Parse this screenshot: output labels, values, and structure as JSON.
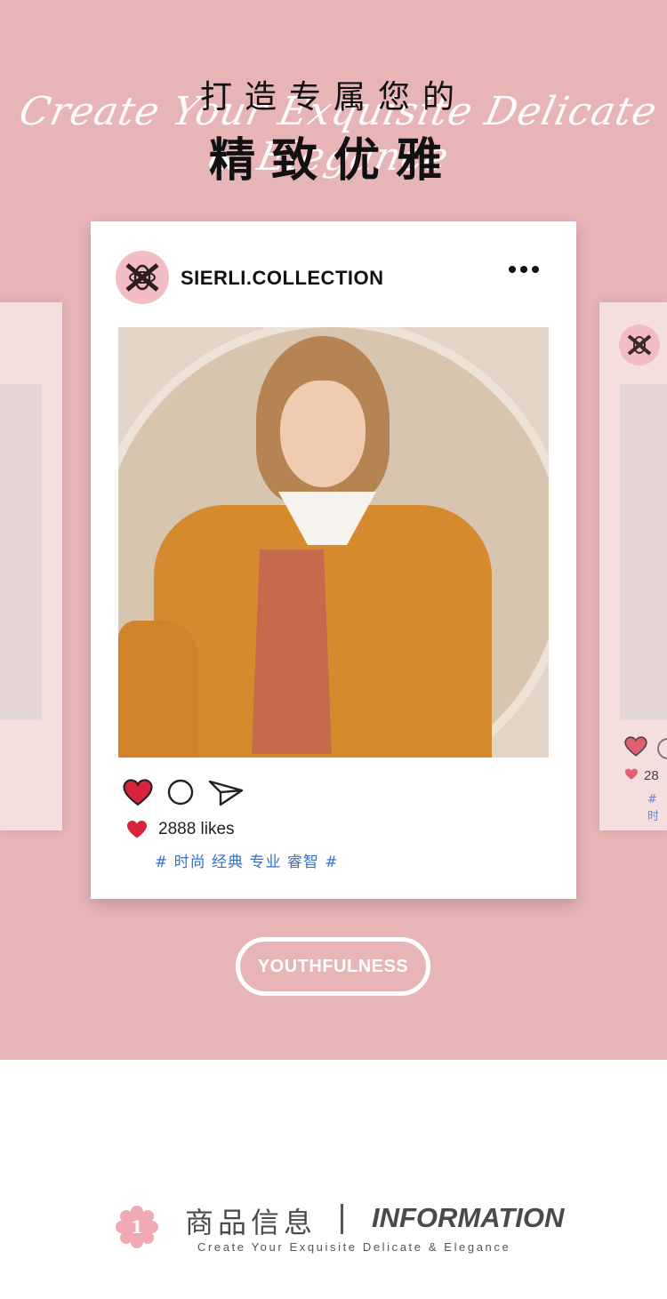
{
  "header": {
    "title_line1": "打造专属您的",
    "title_line2": "精致优雅",
    "script_text": "Create Your Exquisite Delicate & Elegance"
  },
  "post": {
    "username": "SIERLI.COLLECTION",
    "likes_text": "2888 likes",
    "tags": "# 时尚 经典 专业 睿智 #"
  },
  "side_post": {
    "likes_text": "28",
    "tags": "# 时"
  },
  "badge": {
    "label": "YOUTHFULNESS"
  },
  "info": {
    "number": "1",
    "title_cn": "商品信息",
    "title_en": "INFORMATION",
    "subtitle": "Create Your Exquisite Delicate & Elegance"
  },
  "colors": {
    "background_pink": "#e8b5b7",
    "heart_red": "#d9243e",
    "tag_blue": "#3470c4",
    "avatar_pink": "#f3bcc5"
  },
  "icons": [
    "heart-icon",
    "comment-icon",
    "send-icon",
    "more-icon",
    "brand-logo-icon",
    "flower-badge-icon"
  ]
}
